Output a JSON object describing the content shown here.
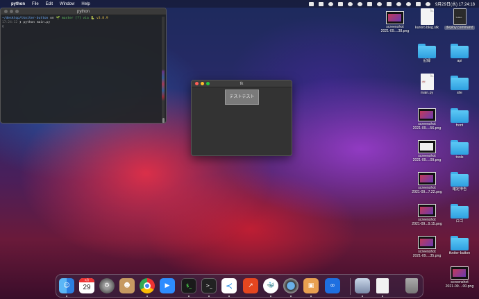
{
  "menubar": {
    "apple_glyph": "",
    "app_name": "python",
    "items": [
      "File",
      "Edit",
      "Window",
      "Help"
    ],
    "clock": "9月29日(水)  17:24:18"
  },
  "terminal": {
    "title": "python",
    "line1_path": "~/desktop/tkniter-button",
    "line1_on": "on",
    "line1_branch": "🌱 master [?] via",
    "line1_py": "🐍 v3.8.9",
    "line2_time": "17:24:12",
    "line2_cmd": "❯ python main.py",
    "line3": "▯"
  },
  "tk_window": {
    "title": "tk",
    "button_label": "テストテスト"
  },
  "desktop_icons": [
    {
      "label": "screenshot\n2021-09....38.png",
      "kind": "thumb"
    },
    {
      "label": "kuroro.blog.stk",
      "kind": "doc"
    },
    {
      "label": "deploy.command",
      "kind": "doc-dark"
    },
    {
      "label": "記録",
      "kind": "folder"
    },
    {
      "label": "api",
      "kind": "folder"
    },
    {
      "label": "main.py",
      "kind": "doc"
    },
    {
      "label": "site",
      "kind": "folder"
    },
    {
      "label": "screenshot\n2021-09....56.png",
      "kind": "thumb"
    },
    {
      "label": "front",
      "kind": "folder"
    },
    {
      "label": "screenshot\n2021-09....09.png",
      "kind": "thumb-white"
    },
    {
      "label": "tools",
      "kind": "folder"
    },
    {
      "label": "screenshot\n2021-09...7.22.png",
      "kind": "thumb"
    },
    {
      "label": "確定申告",
      "kind": "folder"
    },
    {
      "label": "screenshot\n2021-09...9.15.png",
      "kind": "thumb"
    },
    {
      "label": "ロゴ",
      "kind": "folder"
    },
    {
      "label": "screenshot\n2021-09....35.png",
      "kind": "thumb"
    },
    {
      "label": "tkniter-button",
      "kind": "folder"
    },
    {
      "label": "screenshot\n2021-09....00.png",
      "kind": "thumb"
    }
  ],
  "dock": {
    "calendar_month": "9月",
    "calendar_day": "29",
    "apps": [
      "finder",
      "calendar",
      "system-preferences",
      "contacts",
      "chrome",
      "zoom",
      "terminal-green",
      "terminal",
      "vscode",
      "instruments",
      "docker",
      "quicktime",
      "preview",
      "infinity",
      "photo-viewer",
      "document",
      "trash"
    ]
  },
  "colors": {
    "accent_red": "#ff5f57",
    "accent_yellow": "#febc2e",
    "accent_green": "#28c840",
    "folder_blue": "#3fb0ea"
  }
}
